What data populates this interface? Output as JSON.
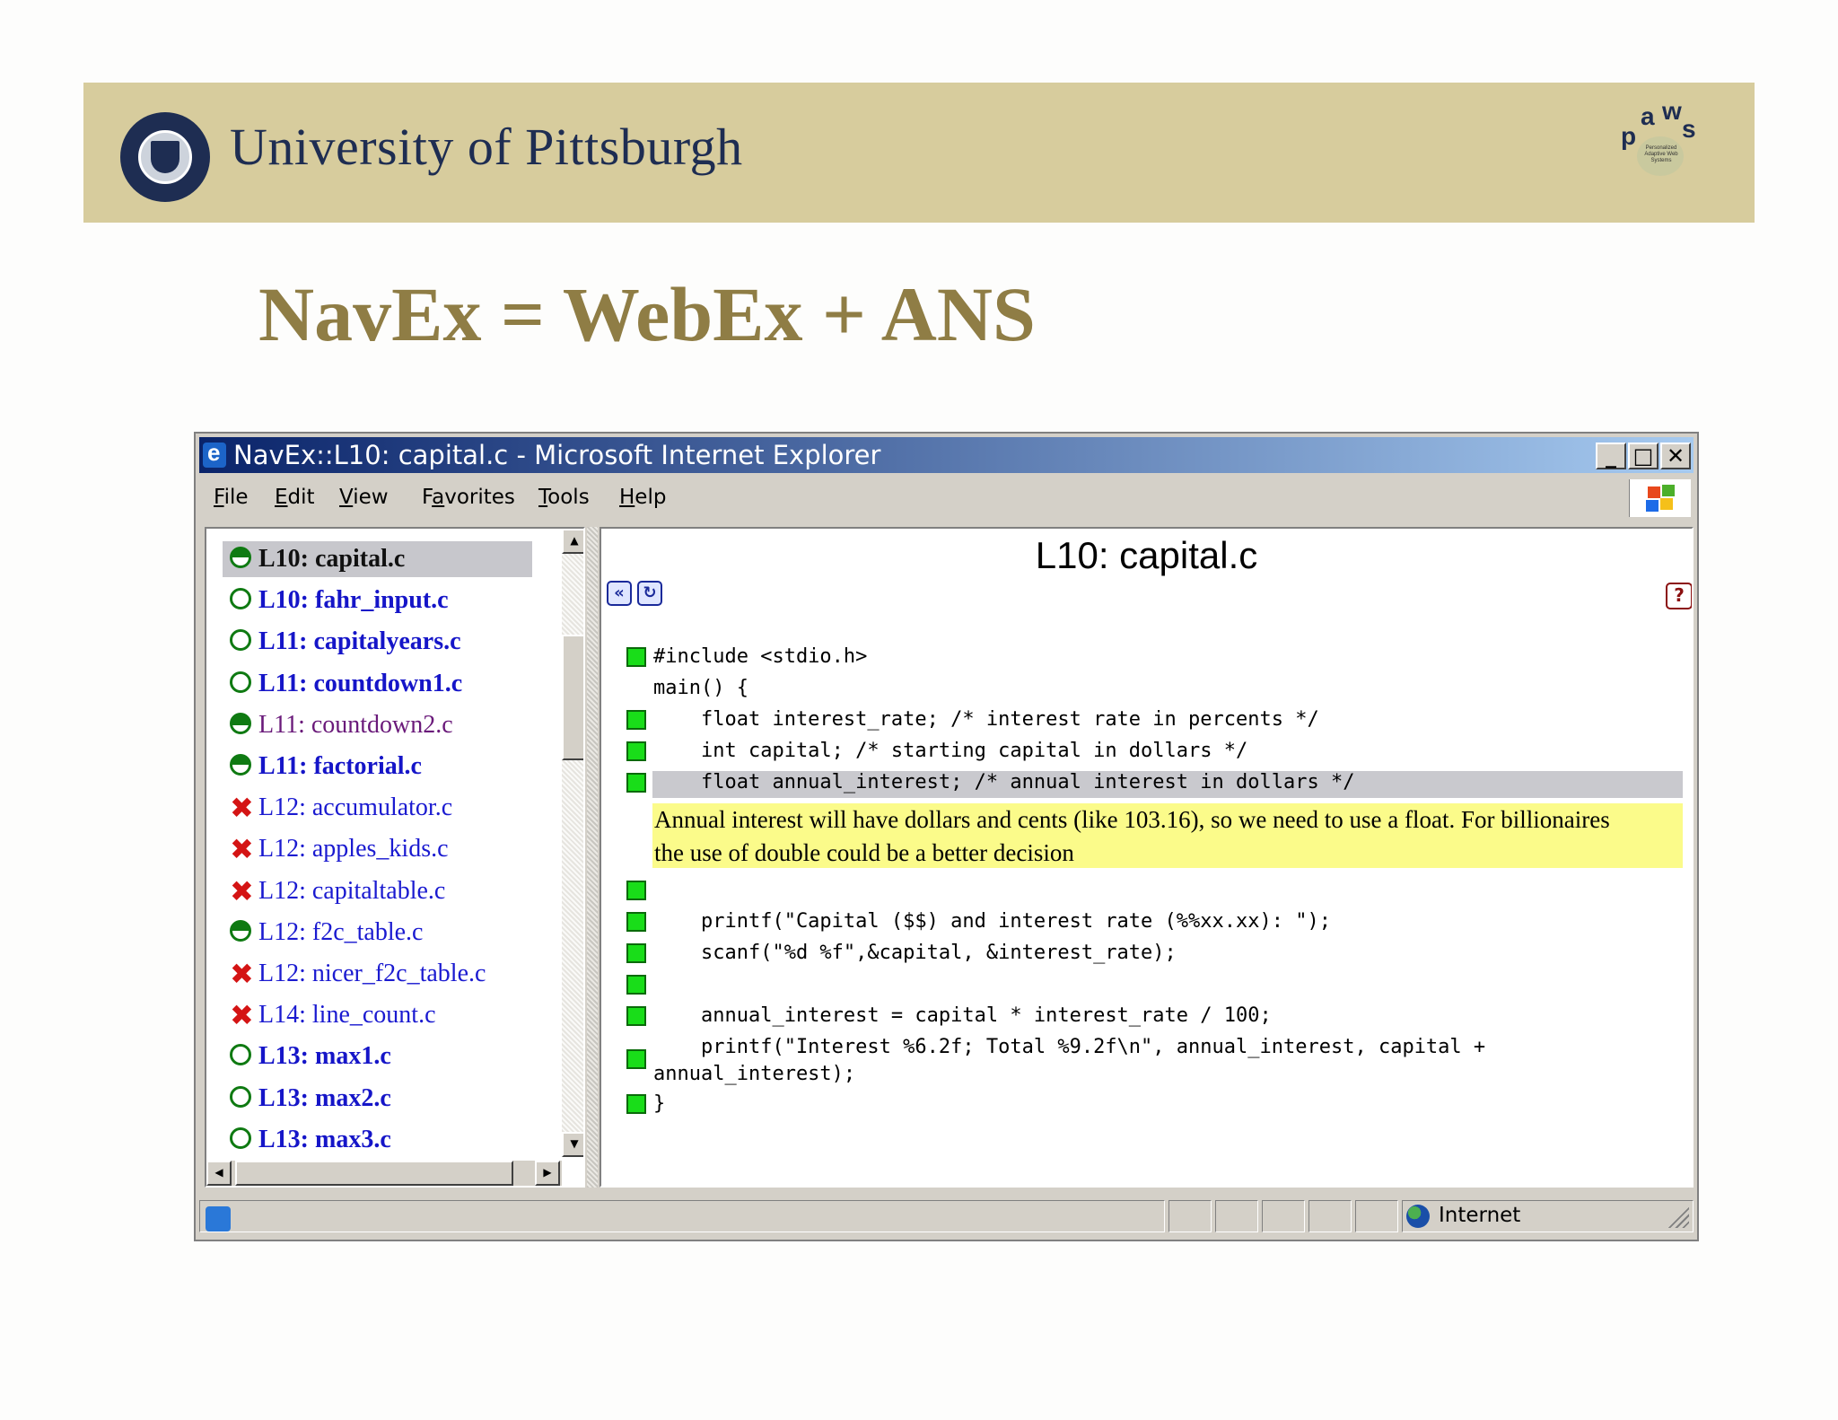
{
  "slide": {
    "university": "University of Pittsburgh",
    "title": "NavEx = WebEx + ANS"
  },
  "window": {
    "title": "NavEx::L10: capital.c - Microsoft Internet Explorer",
    "menu": [
      {
        "label": "File",
        "u": "F",
        "rest": "ile"
      },
      {
        "label": "Edit",
        "u": "E",
        "rest": "dit"
      },
      {
        "label": "View",
        "u": "V",
        "rest": "iew"
      },
      {
        "label": "Favorites",
        "pre": "F",
        "u": "a",
        "rest": "vorites"
      },
      {
        "label": "Tools",
        "u": "T",
        "rest": "ools"
      },
      {
        "label": "Help",
        "u": "H",
        "rest": "elp"
      }
    ],
    "status_zone": "Internet"
  },
  "nav_list": [
    {
      "label": "L10: capital.c",
      "status": "half",
      "style": "bold-black",
      "selected": true
    },
    {
      "label": "L10: fahr_input.c",
      "status": "empty",
      "style": "bold-blue"
    },
    {
      "label": "L11: capitalyears.c",
      "status": "empty",
      "style": "bold-blue"
    },
    {
      "label": "L11: countdown1.c",
      "status": "empty",
      "style": "bold-blue"
    },
    {
      "label": "L11: countdown2.c",
      "status": "full",
      "style": "plain-purple"
    },
    {
      "label": "L11: factorial.c",
      "status": "half",
      "style": "bold-blue"
    },
    {
      "label": "L12: accumulator.c",
      "status": "x",
      "style": "plain-blue"
    },
    {
      "label": "L12: apples_kids.c",
      "status": "x",
      "style": "plain-blue"
    },
    {
      "label": "L12: capitaltable.c",
      "status": "x",
      "style": "plain-blue"
    },
    {
      "label": "L12: f2c_table.c",
      "status": "half",
      "style": "plain-blue"
    },
    {
      "label": "L12: nicer_f2c_table.c",
      "status": "x",
      "style": "plain-blue"
    },
    {
      "label": "L14: line_count.c",
      "status": "x",
      "style": "plain-blue"
    },
    {
      "label": "L13: max1.c",
      "status": "empty",
      "style": "bold-blue"
    },
    {
      "label": "L13: max2.c",
      "status": "empty",
      "style": "bold-blue"
    },
    {
      "label": "L13: max3.c",
      "status": "empty",
      "style": "bold-blue"
    }
  ],
  "content": {
    "title": "L10: capital.c",
    "code": [
      "#include <stdio.h>",
      "main() {",
      "    float interest_rate; /* interest rate in percents */",
      "    int capital; /* starting capital in dollars */",
      "    float annual_interest; /* annual interest in dollars */",
      "    printf(\"Capital ($$) and interest rate (%%xx.xx): \");",
      "    scanf(\"%d %f\",&capital, &interest_rate);",
      "    annual_interest = capital * interest_rate / 100;",
      "    printf(\"Interest %6.2f; Total %9.2f\\n\", annual_interest, capital +",
      "annual_interest);",
      "}"
    ],
    "note_lines": [
      "Annual interest will have dollars and cents (like 103.16), so we need to use a float. For billionaires",
      "the use of double could be a better decision"
    ]
  },
  "logo": {
    "paws_letters": [
      "p",
      "a",
      "w",
      "s"
    ],
    "paws_sub": "Personalized Adaptive Web Systems"
  },
  "colors": {
    "banner": "#d7cc9d",
    "title": "#8f7d45",
    "navy": "#1e2d52",
    "note_highlight": "#fbfb8a",
    "bullet": "#19dd19"
  }
}
